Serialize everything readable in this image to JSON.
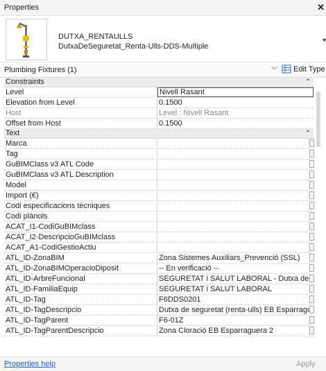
{
  "window": {
    "title": "Properties"
  },
  "type_selector": {
    "family": "DUTXA_RENTAULLS",
    "type": "DutxaDeSeguretat_Renta-Ulls-DDS-Multiple"
  },
  "category_bar": {
    "label": "Plumbing Fixtures (1)",
    "edit_type": "Edit Type"
  },
  "sections": [
    {
      "title": "Constraints",
      "collapse": "⌃",
      "rows": [
        {
          "name": "Level",
          "value": "Nivell Rasant",
          "boxed": true
        },
        {
          "name": "Elevation from Level",
          "value": "0.1500"
        },
        {
          "name": "Host",
          "value": "Level : Nivell Rasant",
          "dim": true
        },
        {
          "name": "Offset from Host",
          "value": "0.1500"
        }
      ]
    },
    {
      "title": "Text",
      "collapse": "⌃",
      "rows": [
        {
          "name": "Marca",
          "value": ""
        },
        {
          "name": "Tag",
          "value": ""
        },
        {
          "name": "GuBIMClass v3 ATL Code",
          "value": ""
        },
        {
          "name": "GuBIMClass v3 ATL Description",
          "value": ""
        },
        {
          "name": "Model",
          "value": ""
        },
        {
          "name": "Import (€)",
          "value": ""
        },
        {
          "name": "Codi especificacions tècniques",
          "value": ""
        },
        {
          "name": "Codi plànols",
          "value": ""
        },
        {
          "name": "ACAT_I1-CodiGuBIMclass",
          "value": ""
        },
        {
          "name": "ACAT_I2-DescripcioGuBIMclass",
          "value": ""
        },
        {
          "name": "ACAT_A1-CodiGestioActiu",
          "value": ""
        },
        {
          "name": "ATL_ID-ZonaBIM",
          "value": "Zona Sistemes Auxiliars_Prevenció (SSL)"
        },
        {
          "name": "ATL_ID-ZonaBIMOperacioDiposit",
          "value": "-- En verificació --"
        },
        {
          "name": "ATL_ID-ArbreFuncional",
          "value": "SEGURETAT i SALUT LABORAL - Dutxa de se..."
        },
        {
          "name": "ATL_ID-FamiliaEquip",
          "value": "SEGURETAT i SALUT LABORAL"
        },
        {
          "name": "ATL_ID-Tag",
          "value": "F6DDS0201"
        },
        {
          "name": "ATL_ID-TagDescripcio",
          "value": "Dutxa de seguretat (renta-ulls) EB Esparragu..."
        },
        {
          "name": "ATL_ID-TagParent",
          "value": "F6-01Z"
        },
        {
          "name": "ATL_ID-TagParentDescripcio",
          "value": "Zona Cloració EB Esparraguera 2"
        }
      ]
    }
  ],
  "footer": {
    "help_link": "Properties help",
    "apply_label": "Apply"
  },
  "icons": {
    "close": "close-icon",
    "dropdown": "chevron-down-icon",
    "edit_type": "edit-type-icon",
    "collapse": "collapse-icon",
    "row_button": "ellipsis-button-icon"
  }
}
